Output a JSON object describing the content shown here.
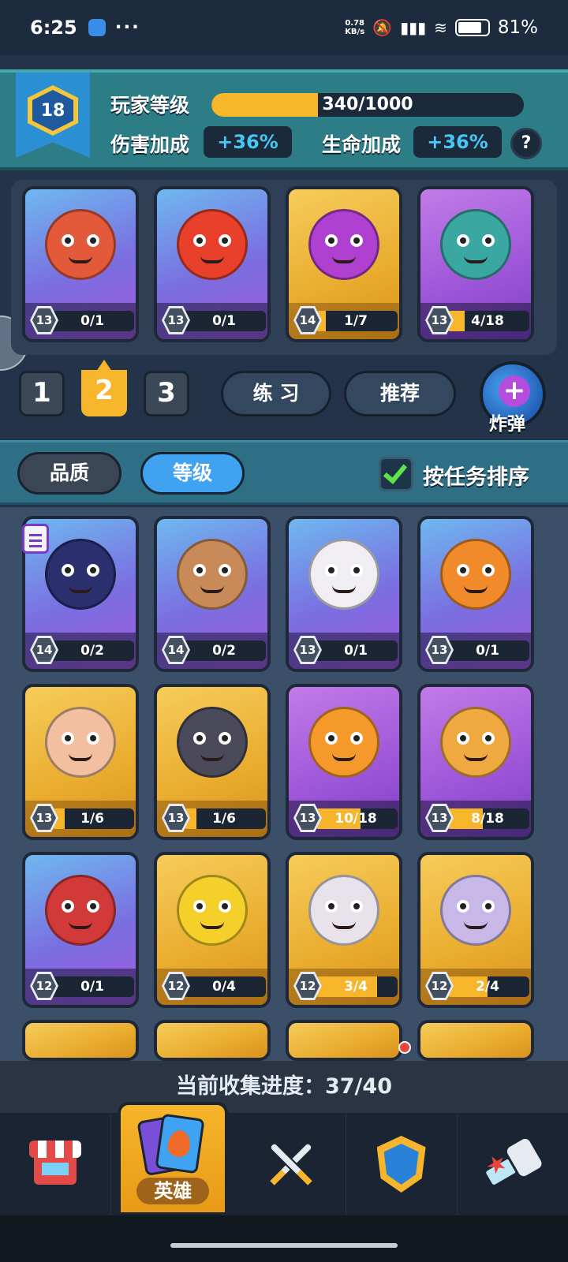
{
  "status_bar": {
    "time": "6:25",
    "app_icon": "app-notification-icon",
    "more": "···",
    "speed_value": "0.78",
    "speed_unit": "KB/s",
    "battery": "81%",
    "battery_level": 0.81
  },
  "player": {
    "level": "18",
    "level_label": "玩家等级",
    "xp_text": "340/1000",
    "xp_fraction": 0.34,
    "damage_label": "伤害加成",
    "damage_value": "+36%",
    "health_label": "生命加成",
    "health_value": "+36%",
    "help": "?"
  },
  "team": {
    "heroes": [
      {
        "level": "13",
        "progress": "0/1",
        "fill": 0,
        "bg": "blue",
        "color": "#e35a3a"
      },
      {
        "level": "13",
        "progress": "0/1",
        "fill": 0,
        "bg": "blue",
        "color": "#e8402a"
      },
      {
        "level": "14",
        "progress": "1/7",
        "fill": 0.1428,
        "bg": "gold",
        "color": "#b040d0"
      },
      {
        "level": "13",
        "progress": "4/18",
        "fill": 0.2222,
        "bg": "purple",
        "color": "#3aa8a0"
      }
    ],
    "slots": [
      "1",
      "2",
      "3"
    ],
    "active_slot": "2",
    "practice_label": "练 习",
    "recommend_label": "推荐",
    "bomb_symbol": "+",
    "bomb_label": "炸弹"
  },
  "filters": {
    "quality_label": "品质",
    "level_label": "等级",
    "active": "level",
    "sort_by_task_label": "按任务排序",
    "sort_by_task_checked": true
  },
  "collection": [
    {
      "level": "14",
      "progress": "0/2",
      "fill": 0,
      "bg": "blue",
      "color": "#2a2f6e"
    },
    {
      "level": "14",
      "progress": "0/2",
      "fill": 0,
      "bg": "blue",
      "color": "#c98a5a"
    },
    {
      "level": "13",
      "progress": "0/1",
      "fill": 0,
      "bg": "blue",
      "color": "#f0eef2"
    },
    {
      "level": "13",
      "progress": "0/1",
      "fill": 0,
      "bg": "blue",
      "color": "#f08a2a"
    },
    {
      "level": "13",
      "progress": "1/6",
      "fill": 0.1667,
      "bg": "gold",
      "color": "#f2c0a0"
    },
    {
      "level": "13",
      "progress": "1/6",
      "fill": 0.1667,
      "bg": "gold",
      "color": "#4a4a5a"
    },
    {
      "level": "13",
      "progress": "10/18",
      "fill": 0.5556,
      "bg": "purple",
      "color": "#f59a2a"
    },
    {
      "level": "13",
      "progress": "8/18",
      "fill": 0.4444,
      "bg": "purple",
      "color": "#f0a840"
    },
    {
      "level": "12",
      "progress": "0/1",
      "fill": 0,
      "bg": "blue",
      "color": "#d23a3a"
    },
    {
      "level": "12",
      "progress": "0/4",
      "fill": 0,
      "bg": "gold",
      "color": "#f5d02a"
    },
    {
      "level": "12",
      "progress": "3/4",
      "fill": 0.75,
      "bg": "gold",
      "color": "#e8e2ea"
    },
    {
      "level": "12",
      "progress": "2/4",
      "fill": 0.5,
      "bg": "gold",
      "color": "#c8b8e8"
    }
  ],
  "collection_progress": "当前收集进度：37/40",
  "nav": {
    "items": [
      "shop-icon",
      "heroes-icon",
      "battle-icon",
      "clan-icon",
      "punch-icon"
    ],
    "active_label": "英雄"
  },
  "colors": {
    "accent_gold": "#f6b52b",
    "accent_blue": "#3fa3f2",
    "value_cyan": "#46c7f5"
  }
}
